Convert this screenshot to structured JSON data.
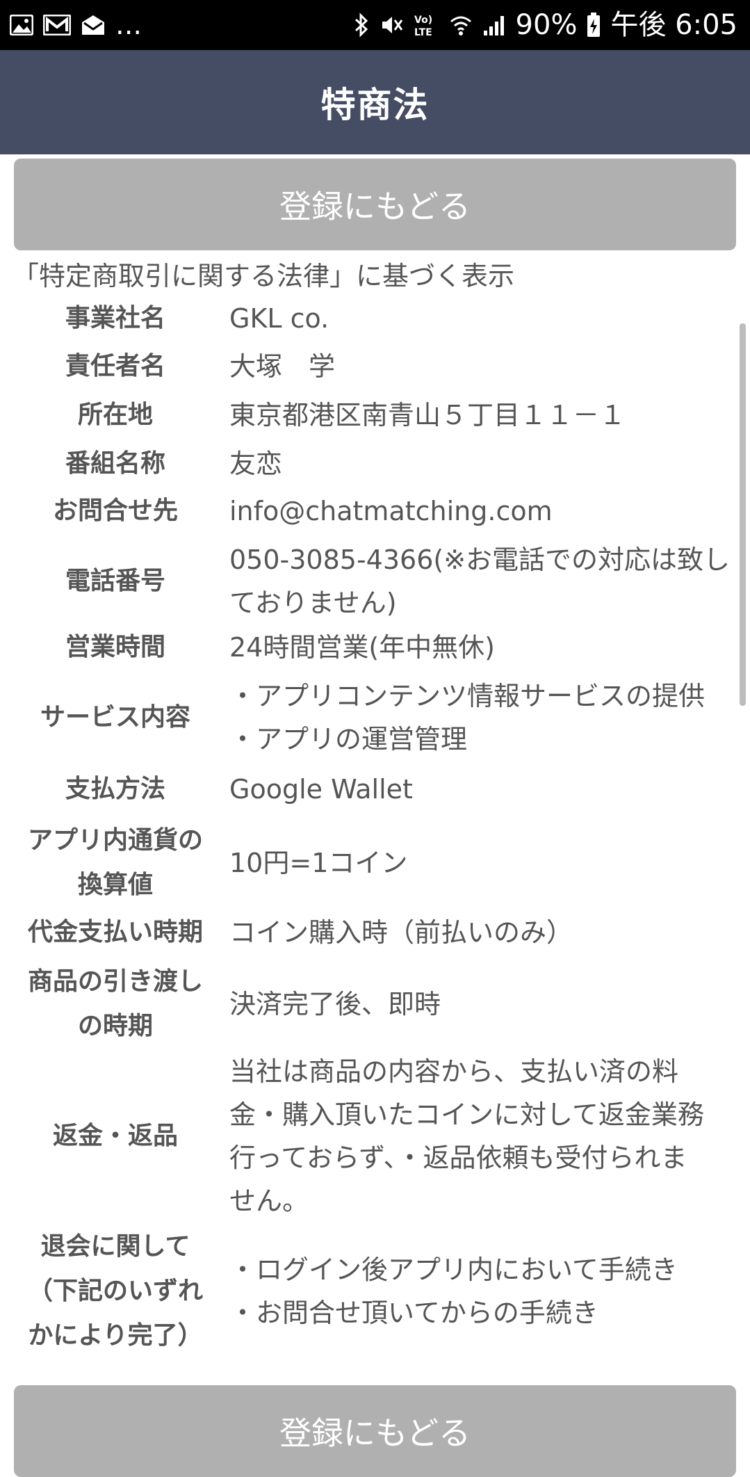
{
  "status_bar": {
    "icons_left": [
      "image-icon",
      "gmail-icon",
      "email-icon"
    ],
    "more": "...",
    "icons_right": [
      "bluetooth-icon",
      "mute-icon",
      "volte-icon",
      "wifi-icon",
      "signal-icon"
    ],
    "battery": "90%",
    "time": "午後 6:05"
  },
  "header": {
    "title": "特商法"
  },
  "buttons": {
    "back_top": "登録にもどる",
    "back_bottom": "登録にもどる"
  },
  "intro": "「特定商取引に関する法律」に基づく表示",
  "rows": [
    {
      "label": [
        "事業社名"
      ],
      "value": [
        "GKL co."
      ]
    },
    {
      "label": [
        "責任者名"
      ],
      "value": [
        "大塚　学"
      ]
    },
    {
      "label": [
        "所在地"
      ],
      "value": [
        "東京都港区南青山５丁目１１－１"
      ]
    },
    {
      "label": [
        "番組名称"
      ],
      "value": [
        "友恋"
      ]
    },
    {
      "label": [
        "お問合せ先"
      ],
      "value": [
        "info@chatmatching.com"
      ]
    },
    {
      "label": [
        "電話番号"
      ],
      "value": [
        "050-3085-4366(※お電話での対応は致し",
        "ておりません)"
      ]
    },
    {
      "label": [
        "営業時間"
      ],
      "value": [
        "24時間営業(年中無休)"
      ]
    },
    {
      "label": [
        "サービス内容"
      ],
      "value": [
        "・アプリコンテンツ情報サービスの提供",
        "・アプリの運営管理"
      ]
    },
    {
      "label": [
        "支払方法"
      ],
      "value": [
        "Google Wallet"
      ]
    },
    {
      "label": [
        "アプリ内通貨の",
        "換算値"
      ],
      "value": [
        "10円=1コイン"
      ]
    },
    {
      "label": [
        "代金支払い時期"
      ],
      "value": [
        "コイン購入時（前払いのみ）"
      ]
    },
    {
      "label": [
        "商品の引き渡し",
        "の時期"
      ],
      "value": [
        "決済完了後、即時"
      ]
    },
    {
      "label": [
        "返金・返品"
      ],
      "value": [
        "当社は商品の内容から、支払い済の料",
        "金・購入頂いたコインに対して返金業務",
        "行っておらず、・返品依頼も受付られま",
        "せん。"
      ]
    },
    {
      "label": [
        "退会に関して",
        "（下記のいずれ",
        "かにより完了）"
      ],
      "value": [
        "・ログイン後アプリ内において手続き",
        "・お問合せ頂いてからの手続き"
      ]
    }
  ]
}
